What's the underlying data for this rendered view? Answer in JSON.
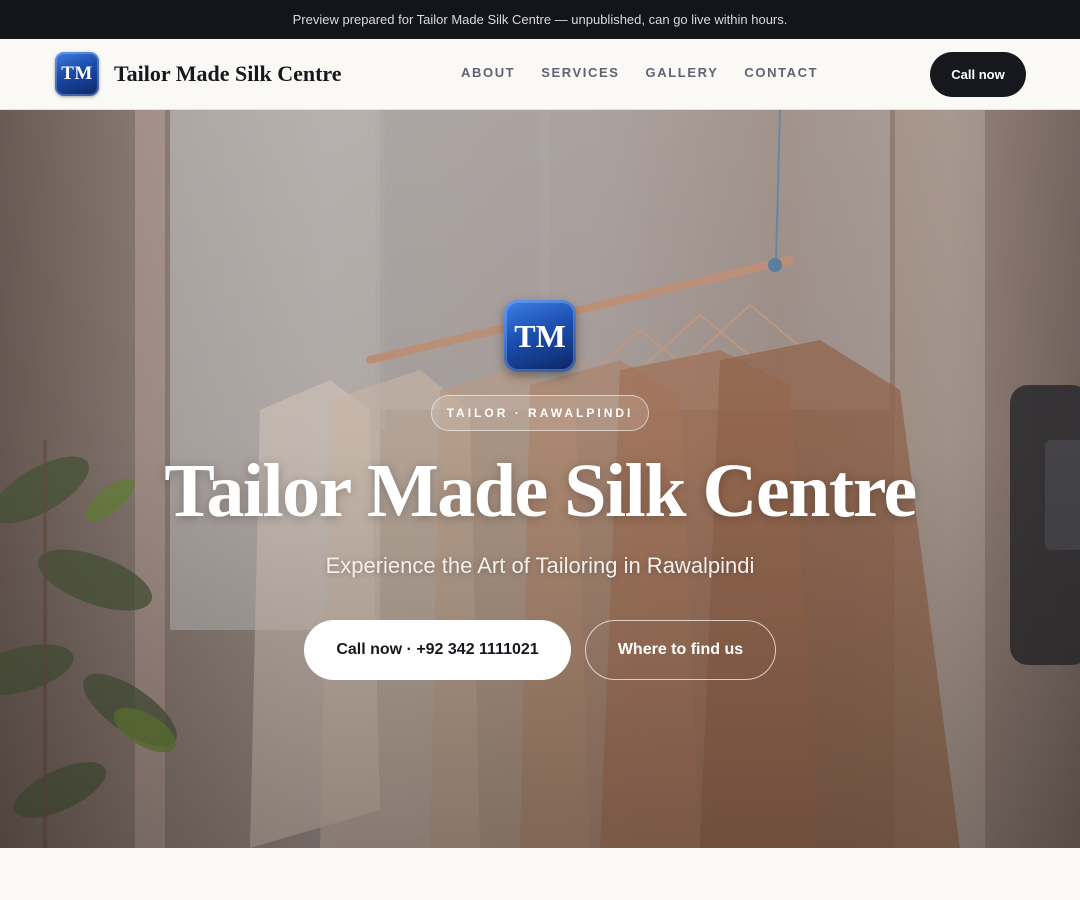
{
  "announcement": "Preview prepared for Tailor Made Silk Centre — unpublished, can go live within hours.",
  "header": {
    "logo_text": "TM",
    "brand_name": "Tailor Made Silk Centre",
    "nav": [
      "ABOUT",
      "SERVICES",
      "GALLERY",
      "CONTACT"
    ],
    "cta": "Call now"
  },
  "hero": {
    "logo_text": "TM",
    "tag": "TAILOR · RAWALPINDI",
    "title": "Tailor Made Silk Centre",
    "subtitle": "Experience the Art of Tailoring in Rawalpindi",
    "primary_button": "Call now · +92 342 1111021",
    "secondary_button": "Where to find us"
  },
  "colors": {
    "topbar_bg": "#13151b",
    "dark_button": "#16181d",
    "logo_blue": "#1a4aa8",
    "page_bg": "#faf9f6"
  }
}
